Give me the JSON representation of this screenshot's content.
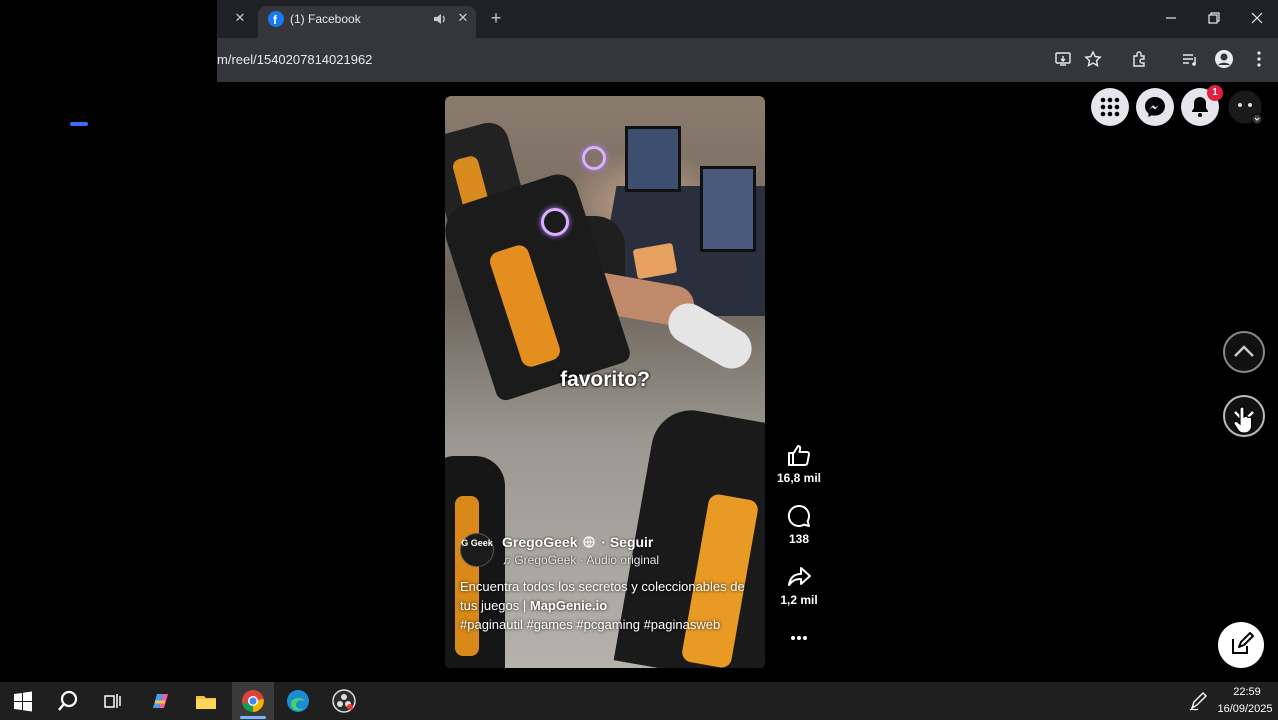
{
  "browser": {
    "tabs": [
      {
        "title": "(1) Facebook",
        "active": true,
        "audio": true
      }
    ],
    "url": "m/reel/1540207814021962"
  },
  "reel": {
    "caption_overlay": "favorito?",
    "avatar_text": "G Geek",
    "author": "GregoGeek",
    "follow_label": "· Seguir",
    "audio": "GregoGeek · Audio original",
    "description_line1": "Encuentra todos los secretos y coleccionables de tus juegos | ",
    "description_link": "MapGenie.io",
    "hashtags": "#paginautil #games #pcgaming #paginasweb",
    "likes": "16,8 mil",
    "comments": "138",
    "shares": "1,2 mil"
  },
  "header": {
    "notification_count": "1"
  },
  "taskbar": {
    "time": "22:59",
    "date": "16/09/2025"
  },
  "colors": {
    "facebook_blue": "#1877f2",
    "notification_red": "#e41e3f",
    "chair_orange": "#e38e1f"
  }
}
